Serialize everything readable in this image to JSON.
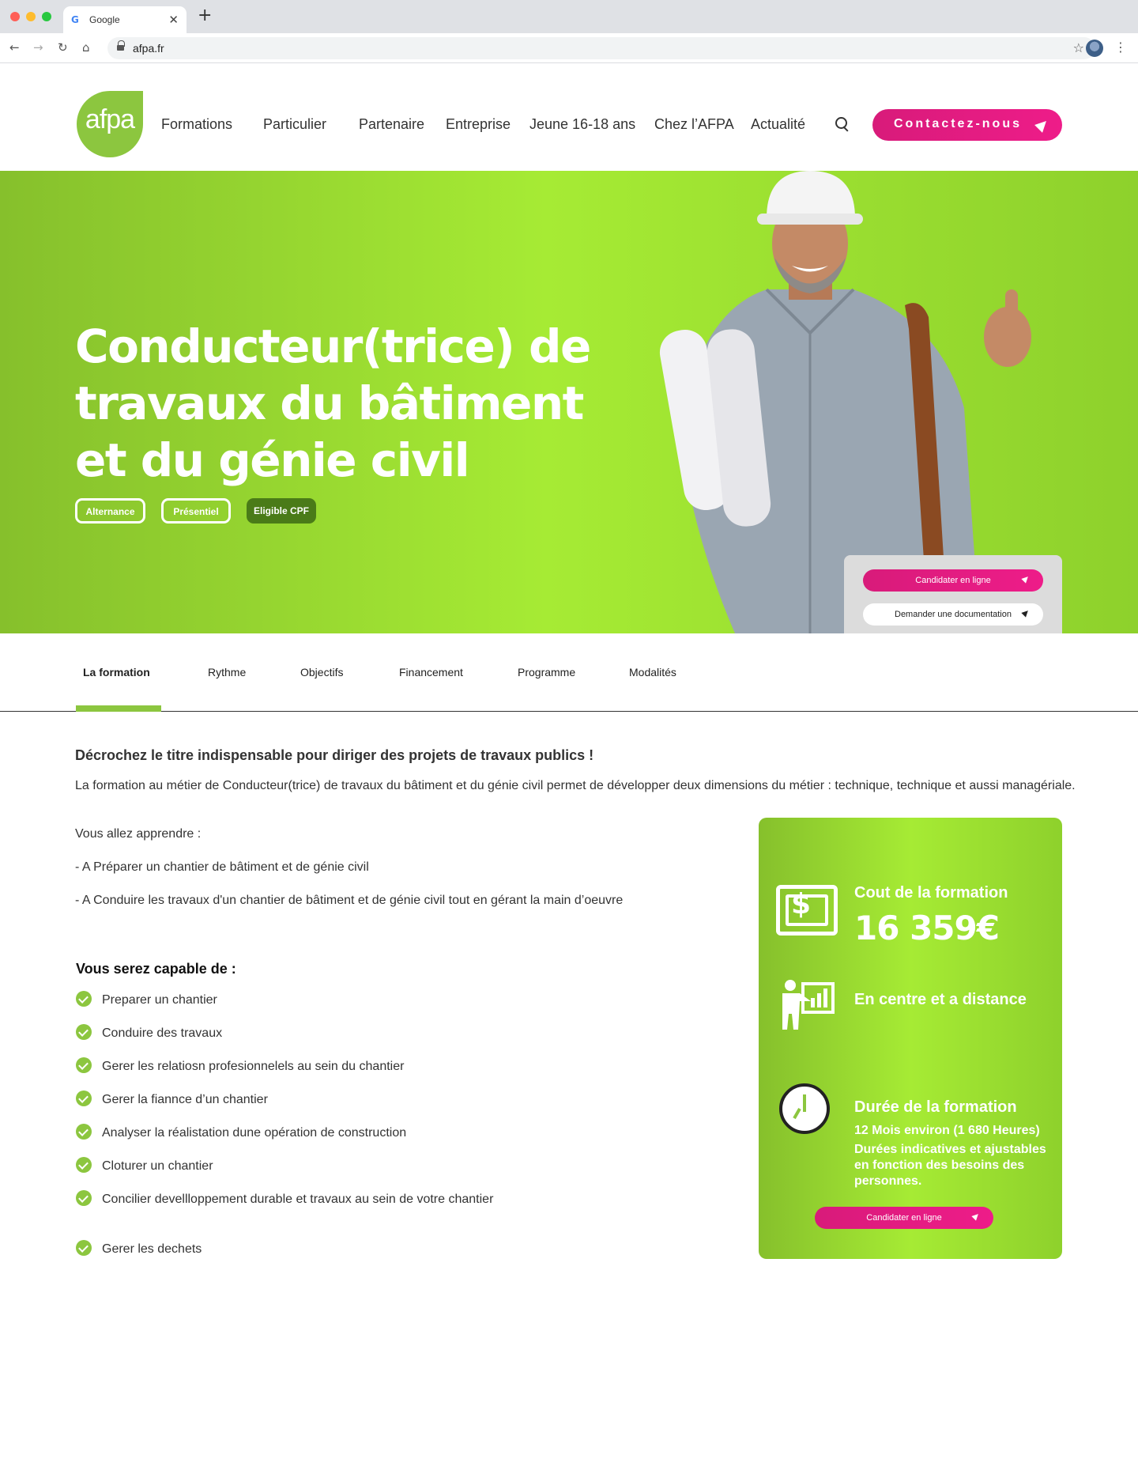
{
  "browser": {
    "tab_title": "Google",
    "tab_favicon": "G",
    "tab_close": "✕",
    "new_tab": "+",
    "back": "←",
    "forward": "→",
    "reload": "↻",
    "home": "⌂",
    "url": "afpa.fr",
    "bookmark": "☆",
    "menu": "⋮"
  },
  "header": {
    "logo_text": "afpa",
    "nav": [
      "Formations",
      "Particulier",
      "Partenaire",
      "Entreprise",
      "Jeune 16-18 ans",
      "Chez l’AFPA",
      "Actualité"
    ],
    "contact_label": "Contactez-nous"
  },
  "hero": {
    "title": "Conducteur(trice) de travaux du bâtiment et du génie civil",
    "tags": [
      "Alternance",
      "Présentiel",
      "Eligible CPF"
    ],
    "apply_label": "Candidater en ligne",
    "doc_label": "Demander une documentation"
  },
  "tabs": [
    "La formation",
    "Rythme",
    "Objectifs",
    "Financement",
    "Programme",
    "Modalités"
  ],
  "main": {
    "heading": "Décrochez le titre indispensable pour diriger des projets de travaux publics !",
    "intro": "La formation au métier de Conducteur(trice) de travaux du bâtiment et du génie civil permet de développer deux dimensions du métier : technique, technique et aussi managériale.",
    "learn_title": "Vous allez apprendre :",
    "learn_items": [
      "-  A Préparer un chantier de bâtiment et de génie civil",
      "-  A Conduire les travaux d'un chantier de bâtiment et de génie civil tout en gérant la main d’oeuvre"
    ],
    "capable_title": "Vous serez capable de :",
    "skills": [
      "Preparer un chantier",
      "Conduire des travaux",
      "Gerer les relatiosn profesionnelels au sein du chantier",
      "Gerer la fiannce d’un chantier",
      "Analyser la réalistation dune opération de construction",
      "Cloturer un chantier",
      "Concilier devellloppement durable et travaux au sein de votre chantier",
      "Gerer les dechets"
    ]
  },
  "card": {
    "cost_label": "Cout de la formation",
    "cost_value": "16 359€",
    "mode_label": "En centre et a distance",
    "duration_label": "Durée de la formation",
    "duration_value": "12 Mois environ  (1 680 Heures)",
    "duration_note": "Durées indicatives et ajustables en fonction des besoins des personnes.",
    "apply_label": "Candidater en ligne"
  },
  "colors": {
    "brand_green": "#8cc63f",
    "accent_pink": "#e91e84"
  }
}
